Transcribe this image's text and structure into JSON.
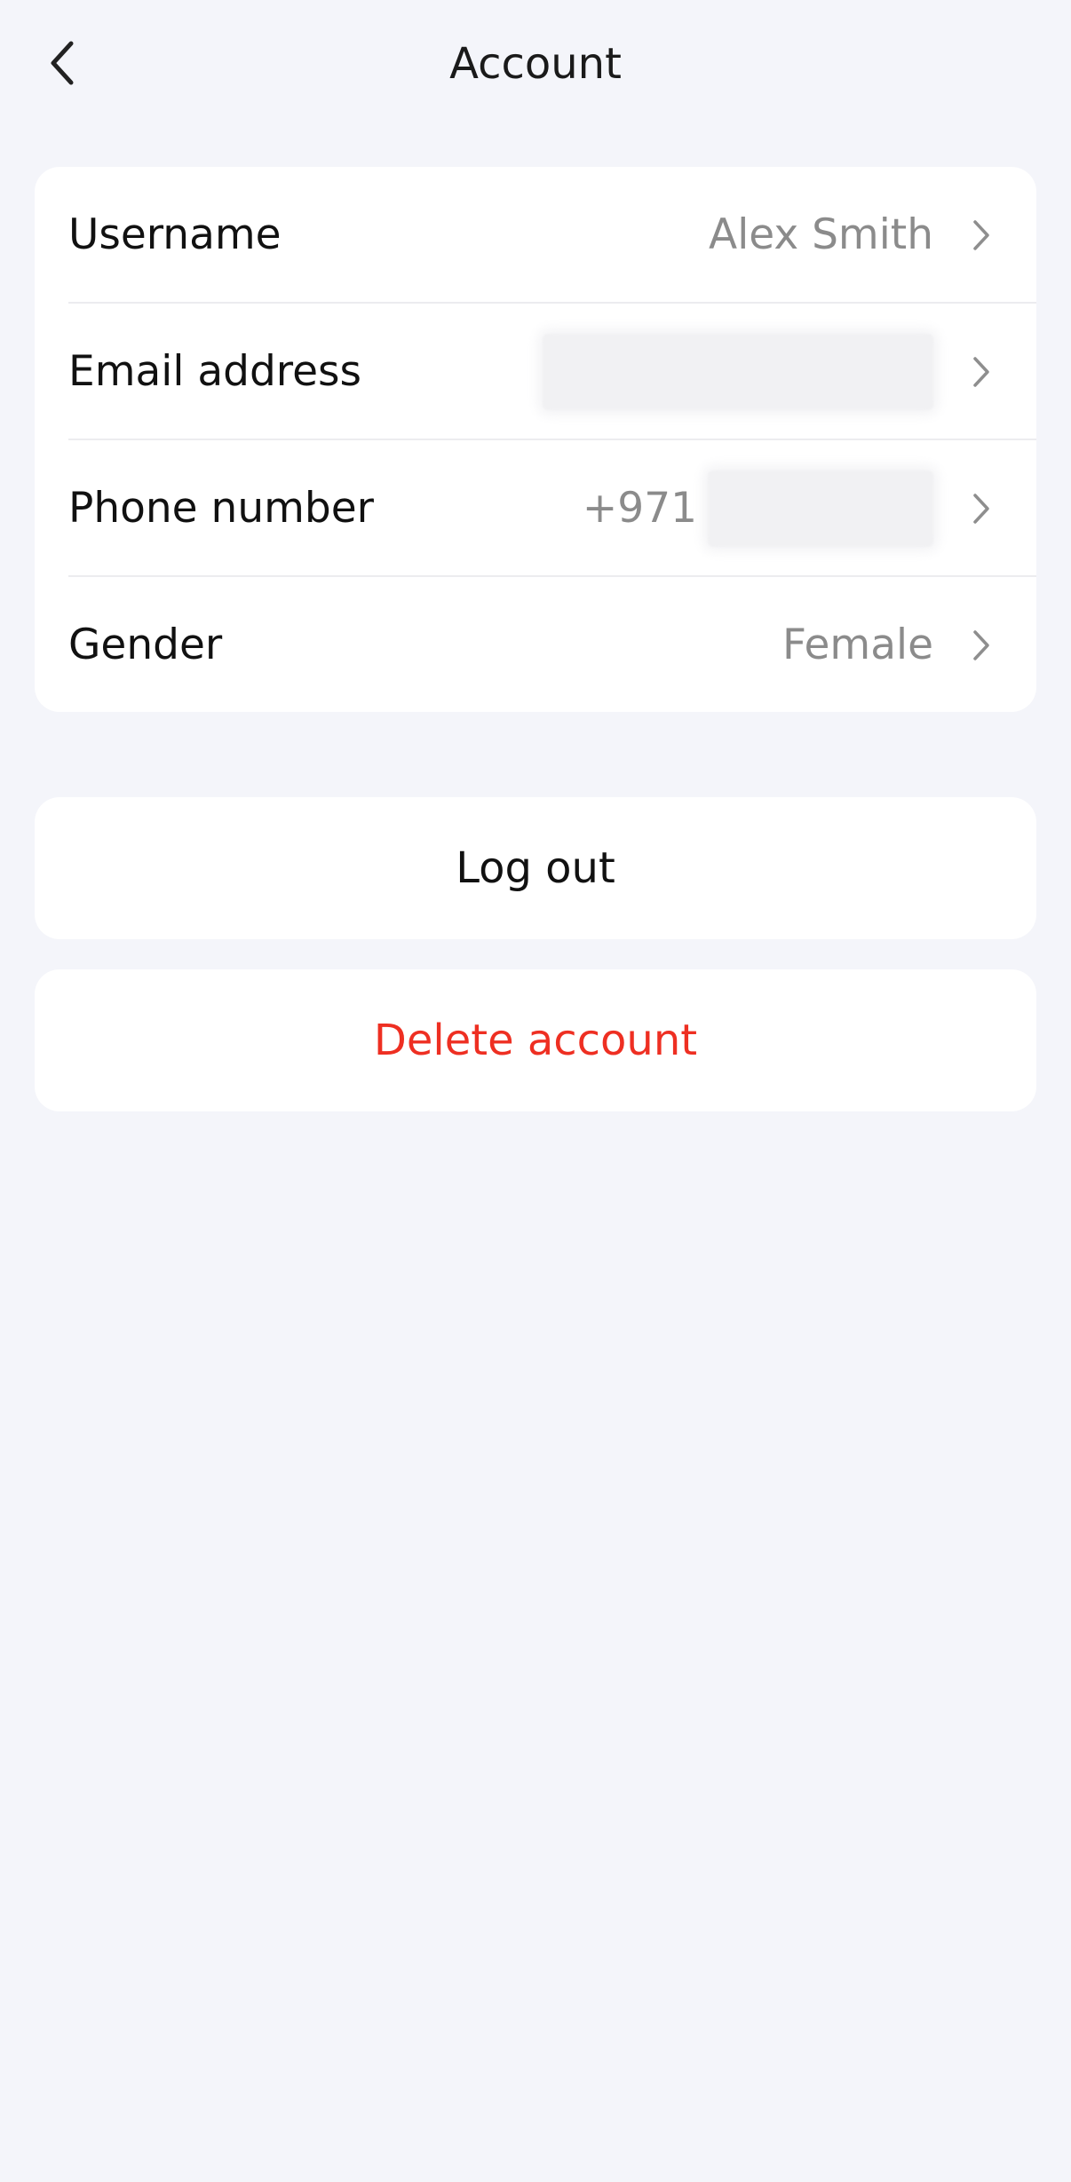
{
  "header": {
    "title": "Account",
    "back_icon": "chevron-left-icon"
  },
  "account": {
    "rows": [
      {
        "label": "Username",
        "value": "Alex Smith"
      },
      {
        "label": "Email address",
        "value": ""
      },
      {
        "label": "Phone number",
        "value": "+971"
      },
      {
        "label": "Gender",
        "value": "Female"
      }
    ],
    "row_icon": "chevron-right-icon"
  },
  "actions": {
    "logout_label": "Log out",
    "delete_label": "Delete account"
  },
  "colors": {
    "background": "#f4f5fa",
    "card": "#ffffff",
    "secondary_text": "#8b8b8b",
    "danger": "#ee2f22"
  }
}
